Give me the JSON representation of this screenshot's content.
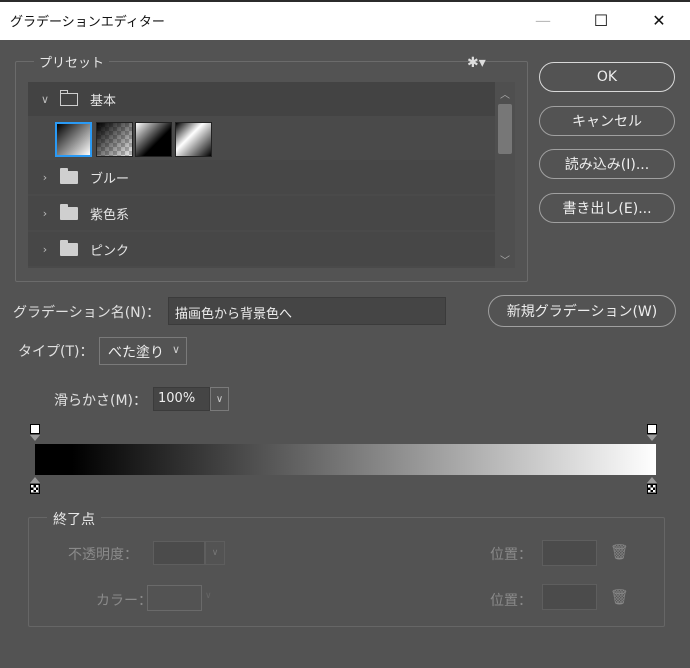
{
  "window": {
    "title": "グラデーションエディター",
    "minimize": "—",
    "maximize": "☐",
    "close": "✕"
  },
  "presets": {
    "label": "プリセット",
    "folders": [
      {
        "name": "基本",
        "expanded": true
      },
      {
        "name": "ブルー",
        "expanded": false
      },
      {
        "name": "紫色系",
        "expanded": false
      },
      {
        "name": "ピンク",
        "expanded": false
      }
    ],
    "selected_swatch": 1
  },
  "buttons": {
    "ok": "OK",
    "cancel": "キャンセル",
    "load": "読み込み(I)...",
    "save": "書き出し(E)...",
    "new_gradient": "新規グラデーション(W)"
  },
  "name": {
    "label": "グラデーション名(N)：",
    "value": "描画色から背景色へ"
  },
  "type": {
    "label": "タイプ(T)：",
    "value": "べた塗り"
  },
  "smoothness": {
    "label": "滑らかさ(M)：",
    "value": "100%"
  },
  "gradient": {
    "start_color": "#000000",
    "end_color": "#ffffff"
  },
  "stops": {
    "label": "終了点",
    "opacity_label": "不透明度：",
    "location_label": "位置：",
    "color_label": "カラー："
  }
}
